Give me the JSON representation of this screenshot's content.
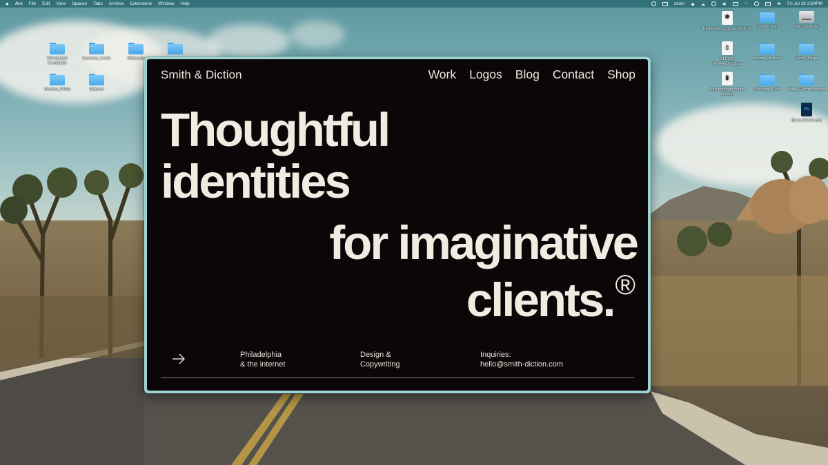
{
  "menubar": {
    "app": "Arc",
    "items": [
      "File",
      "Edit",
      "View",
      "Spaces",
      "Tabs",
      "Archive",
      "Extensions",
      "Window",
      "Help"
    ],
    "zoom_label": "zoom",
    "clock": "Fri Jul 19  3:54PM"
  },
  "desktop": {
    "left_icons": [
      {
        "label": "Wheatpaste thumbnails",
        "kind": "folder"
      },
      {
        "label": "Business_Cards",
        "kind": "folder"
      },
      {
        "label": "Billboards",
        "kind": "folder"
      },
      {
        "label": "",
        "kind": "folder"
      },
      {
        "label": "Shadow_PNGs",
        "kind": "folder"
      },
      {
        "label": "Editorial",
        "kind": "folder"
      }
    ],
    "right_icons": [
      {
        "label": "Perplexity_Logo_Edit_DD.ai",
        "kind": "file"
      },
      {
        "label": "Oceanic Fam",
        "kind": "folder"
      },
      {
        "label": "Macintosh HD",
        "kind": "drive"
      },
      {
        "label": "GLNOD-fXUAAwJnD.jpeg",
        "kind": "file"
      },
      {
        "label": "Internet_Archive",
        "kind": "folder"
      },
      {
        "label": "Social_Swipe",
        "kind": "folder"
      },
      {
        "label": "sign-panthers-script-font.zip",
        "kind": "file"
      },
      {
        "label": "Universal_Sans",
        "kind": "folder"
      },
      {
        "label": "Visual_Electric_Images",
        "kind": "folder"
      },
      {
        "label": "Blurry-Circles.psd",
        "kind": "psd"
      }
    ]
  },
  "site": {
    "brand": "Smith & Diction",
    "nav": [
      "Work",
      "Logos",
      "Blog",
      "Contact",
      "Shop"
    ],
    "headline": {
      "line1": "Thoughtful",
      "line2": "identities",
      "line3": "for imaginative",
      "line4": "clients.",
      "mark": "®"
    },
    "location": {
      "line1": "Philadelphia",
      "line2": "& the internet"
    },
    "services": {
      "line1": "Design &",
      "line2": "Copywriting"
    },
    "inquiries": {
      "line1": "Inquiries:",
      "line2": "hello@smith-diction.com"
    }
  },
  "colors": {
    "site_background": "#0b0709",
    "site_text": "#f1ece2",
    "window_frame": "#9cd4d2",
    "menubar": "#306e76",
    "folder_blue": "#4aaaea"
  }
}
